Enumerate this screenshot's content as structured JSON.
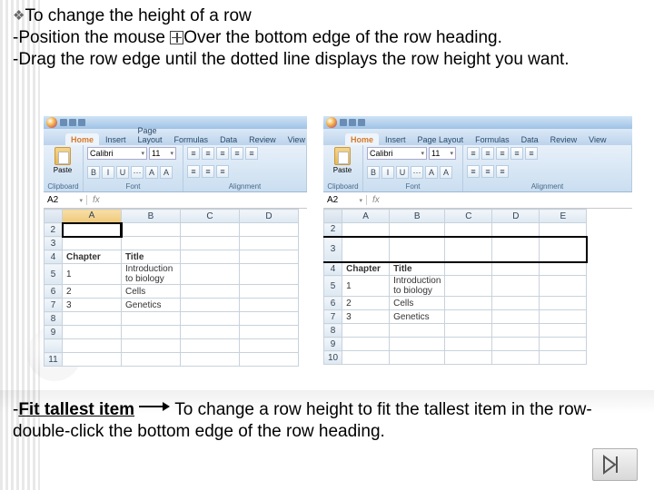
{
  "intro": {
    "heading": "To change the height of a row",
    "line1a": "-Position the mouse ",
    "line1b": "Over the bottom edge of the row heading.",
    "line2": "-Drag the row edge until the dotted line displays the row height you want."
  },
  "ribbon": {
    "tabs": [
      "Home",
      "Insert",
      "Page Layout",
      "Formulas",
      "Data",
      "Review",
      "View"
    ],
    "paste_label": "Paste",
    "clipboard_label": "Clipboard",
    "font_name": "Calibri",
    "font_size": "11",
    "font_label": "Font",
    "alignment_label": "Alignment",
    "namebox": "A2",
    "fx": "fx"
  },
  "gridA": {
    "cols": [
      "A",
      "B",
      "C",
      "D"
    ],
    "rows": [
      "2",
      "3",
      "4",
      "5",
      "6",
      "7",
      "8",
      "9",
      "",
      "11"
    ],
    "data": {
      "4": [
        "Chapter",
        "Title",
        "",
        ""
      ],
      "5": [
        "1",
        "Introduction to biology",
        "",
        ""
      ],
      "6": [
        "2",
        "Cells",
        "",
        ""
      ],
      "7": [
        "3",
        "Genetics",
        "",
        ""
      ]
    }
  },
  "gridB": {
    "cols": [
      "A",
      "B",
      "C",
      "D",
      "E"
    ],
    "rows": [
      "2",
      "3",
      "4",
      "5",
      "6",
      "7",
      "8",
      "9",
      "10"
    ],
    "data": {
      "4": [
        "Chapter",
        "Title",
        "",
        "",
        ""
      ],
      "5": [
        "1",
        "Introduction to biology",
        "",
        "",
        ""
      ],
      "6": [
        "2",
        "Cells",
        "",
        "",
        ""
      ],
      "7": [
        "3",
        "Genetics",
        "",
        "",
        ""
      ]
    }
  },
  "footer": {
    "prefix": "-",
    "bold": "Fit tallest item",
    "rest": "To change a row height to fit the tallest item in the row-double-click the bottom edge of the row heading."
  }
}
